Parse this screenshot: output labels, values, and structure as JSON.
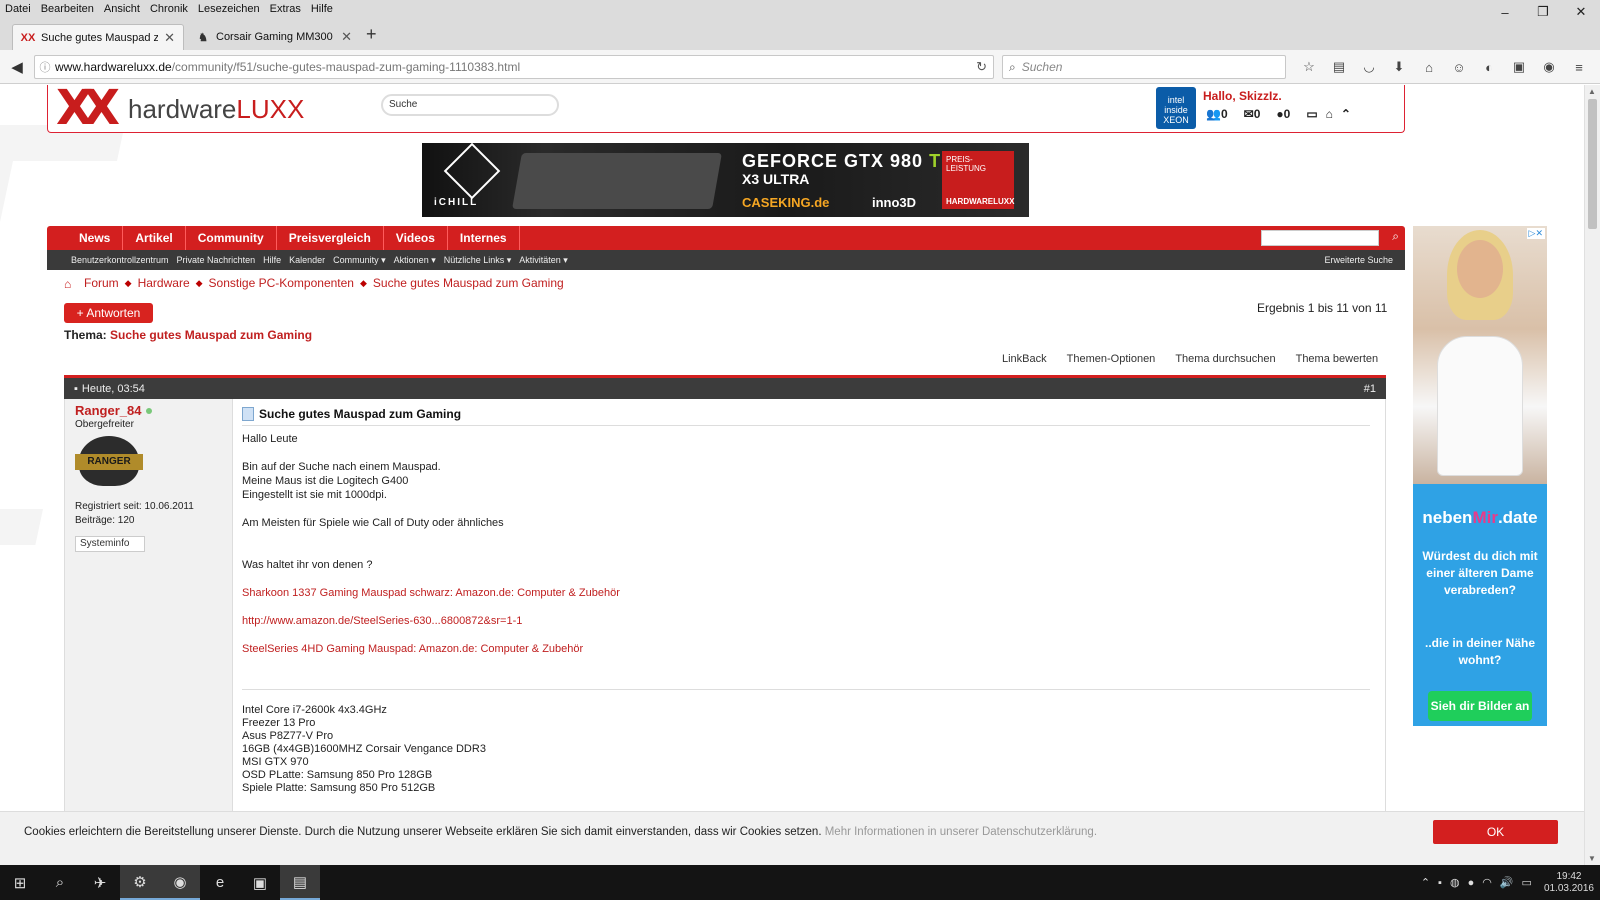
{
  "browser": {
    "menu": [
      "Datei",
      "Bearbeiten",
      "Ansicht",
      "Chronik",
      "Lesezeichen",
      "Extras",
      "Hilfe"
    ],
    "tabs": [
      {
        "title": "Suche gutes Mauspad zu...",
        "favicon": "XX"
      },
      {
        "title": "Corsair Gaming MM300 A..."
      }
    ],
    "url_host": "www.hardwareluxx.de",
    "url_path": "/community/f51/suche-gutes-mauspad-zum-gaming-1110383.html",
    "search_placeholder": "Suchen"
  },
  "site": {
    "logo_brand": "hardware",
    "logo_brand_accent": "LUXX",
    "search_value": "Suche",
    "intel_label": "intel inside XEON",
    "greeting": "Hallo, SkizzIz.",
    "counters": [
      "0",
      "0",
      "0"
    ]
  },
  "banner": {
    "maker": "iCHILL",
    "product_line1": "GEFORCE GTX 980",
    "product_line1_suffix": "Ti",
    "product_line2": "X3 ULTRA",
    "shop": "CASEKING.de",
    "partner": "inno3D",
    "badge_line1": "PREIS-",
    "badge_line2": "LEISTUNG",
    "badge_footer": "HARDWARELUXX"
  },
  "nav": {
    "main": [
      "News",
      "Artikel",
      "Community",
      "Preisvergleich",
      "Videos",
      "Internes"
    ],
    "sub": [
      "Benutzerkontrollzentrum",
      "Private Nachrichten",
      "Hilfe",
      "Kalender",
      "Community ▾",
      "Aktionen ▾",
      "Nützliche Links ▾",
      "Aktivitäten ▾"
    ],
    "advanced_search": "Erweiterte Suche"
  },
  "breadcrumb": [
    "Forum",
    "Hardware",
    "Sonstige PC-Komponenten",
    "Suche gutes Mauspad zum Gaming"
  ],
  "thread": {
    "reply_label": "+ Antworten",
    "result_text": "Ergebnis 1 bis 11 von 11",
    "thema_label": "Thema:",
    "thema_title": "Suche gutes Mauspad zum Gaming",
    "actions": [
      "LinkBack",
      "Themen-Optionen",
      "Thema durchsuchen",
      "Thema bewerten"
    ]
  },
  "post": {
    "date": "Heute, 03:54",
    "number": "#1",
    "username": "Ranger_84",
    "rank": "Obergefreiter",
    "avatar_text": "RANGER",
    "registered": "Registriert seit: 10.06.2011",
    "posts": "Beiträge: 120",
    "sysinfo_label": "Systeminfo",
    "title": "Suche gutes Mauspad zum Gaming",
    "greeting": "Hallo Leute",
    "body_lines": [
      "Bin auf der Suche nach einem Mauspad.",
      "Meine Maus ist die Logitech G400",
      "Eingestellt ist sie mit 1000dpi."
    ],
    "usage": "Am Meisten für Spiele wie Call of Duty oder ähnliches",
    "question": "Was haltet ihr von denen ?",
    "links": [
      "Sharkoon 1337 Gaming Mauspad schwarz: Amazon.de: Computer & Zubehör",
      "http://www.amazon.de/SteelSeries-630...6800872&sr=1-1",
      "SteelSeries 4HD Gaming Mauspad: Amazon.de: Computer & Zubehör"
    ],
    "signature": [
      "Intel Core i7-2600k 4x3.4GHz",
      "Freezer 13 Pro",
      "Asus P8Z77-V Pro",
      "16GB (4x4GB)1600MHZ Corsair Vengance DDR3",
      "MSI GTX 970",
      "OSD PLatte: Samsung 850 Pro 128GB",
      "Spiele Platte: Samsung 850 Pro 512GB"
    ]
  },
  "ad": {
    "brand_a": "neben",
    "brand_b": "Mir",
    "brand_c": ".date",
    "question1": "Würdest du dich mit einer älteren Dame verabreden?",
    "question2": "..die in deiner Nähe wohnt?",
    "cta": "Sieh dir Bilder an"
  },
  "cookie": {
    "text": "Cookies erleichtern die Bereitstellung unserer Dienste. Durch die Nutzung unserer Webseite erklären Sie sich damit einverstanden, dass wir Cookies setzen.",
    "more": "Mehr Informationen in unserer Datenschutzerklärung.",
    "ok": "OK"
  },
  "taskbar": {
    "time": "19:42",
    "date": "01.03.2016"
  },
  "colors": {
    "accent_red": "#d31f1f",
    "link_red": "#c02020",
    "dark_bar": "#3a3a3a",
    "ad_blue": "#2fa2e5"
  }
}
